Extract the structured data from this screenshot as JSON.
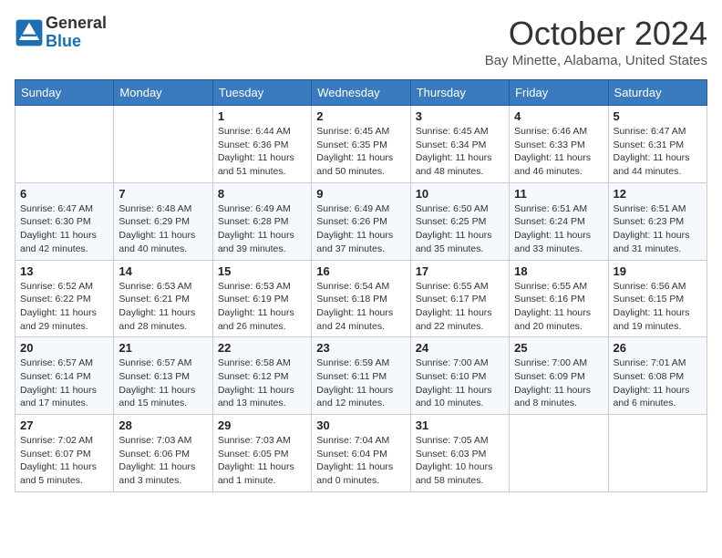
{
  "header": {
    "logo_general": "General",
    "logo_blue": "Blue",
    "month_title": "October 2024",
    "location": "Bay Minette, Alabama, United States"
  },
  "days_of_week": [
    "Sunday",
    "Monday",
    "Tuesday",
    "Wednesday",
    "Thursday",
    "Friday",
    "Saturday"
  ],
  "weeks": [
    [
      {
        "day": "",
        "info": ""
      },
      {
        "day": "",
        "info": ""
      },
      {
        "day": "1",
        "info": "Sunrise: 6:44 AM\nSunset: 6:36 PM\nDaylight: 11 hours and 51 minutes."
      },
      {
        "day": "2",
        "info": "Sunrise: 6:45 AM\nSunset: 6:35 PM\nDaylight: 11 hours and 50 minutes."
      },
      {
        "day": "3",
        "info": "Sunrise: 6:45 AM\nSunset: 6:34 PM\nDaylight: 11 hours and 48 minutes."
      },
      {
        "day": "4",
        "info": "Sunrise: 6:46 AM\nSunset: 6:33 PM\nDaylight: 11 hours and 46 minutes."
      },
      {
        "day": "5",
        "info": "Sunrise: 6:47 AM\nSunset: 6:31 PM\nDaylight: 11 hours and 44 minutes."
      }
    ],
    [
      {
        "day": "6",
        "info": "Sunrise: 6:47 AM\nSunset: 6:30 PM\nDaylight: 11 hours and 42 minutes."
      },
      {
        "day": "7",
        "info": "Sunrise: 6:48 AM\nSunset: 6:29 PM\nDaylight: 11 hours and 40 minutes."
      },
      {
        "day": "8",
        "info": "Sunrise: 6:49 AM\nSunset: 6:28 PM\nDaylight: 11 hours and 39 minutes."
      },
      {
        "day": "9",
        "info": "Sunrise: 6:49 AM\nSunset: 6:26 PM\nDaylight: 11 hours and 37 minutes."
      },
      {
        "day": "10",
        "info": "Sunrise: 6:50 AM\nSunset: 6:25 PM\nDaylight: 11 hours and 35 minutes."
      },
      {
        "day": "11",
        "info": "Sunrise: 6:51 AM\nSunset: 6:24 PM\nDaylight: 11 hours and 33 minutes."
      },
      {
        "day": "12",
        "info": "Sunrise: 6:51 AM\nSunset: 6:23 PM\nDaylight: 11 hours and 31 minutes."
      }
    ],
    [
      {
        "day": "13",
        "info": "Sunrise: 6:52 AM\nSunset: 6:22 PM\nDaylight: 11 hours and 29 minutes."
      },
      {
        "day": "14",
        "info": "Sunrise: 6:53 AM\nSunset: 6:21 PM\nDaylight: 11 hours and 28 minutes."
      },
      {
        "day": "15",
        "info": "Sunrise: 6:53 AM\nSunset: 6:19 PM\nDaylight: 11 hours and 26 minutes."
      },
      {
        "day": "16",
        "info": "Sunrise: 6:54 AM\nSunset: 6:18 PM\nDaylight: 11 hours and 24 minutes."
      },
      {
        "day": "17",
        "info": "Sunrise: 6:55 AM\nSunset: 6:17 PM\nDaylight: 11 hours and 22 minutes."
      },
      {
        "day": "18",
        "info": "Sunrise: 6:55 AM\nSunset: 6:16 PM\nDaylight: 11 hours and 20 minutes."
      },
      {
        "day": "19",
        "info": "Sunrise: 6:56 AM\nSunset: 6:15 PM\nDaylight: 11 hours and 19 minutes."
      }
    ],
    [
      {
        "day": "20",
        "info": "Sunrise: 6:57 AM\nSunset: 6:14 PM\nDaylight: 11 hours and 17 minutes."
      },
      {
        "day": "21",
        "info": "Sunrise: 6:57 AM\nSunset: 6:13 PM\nDaylight: 11 hours and 15 minutes."
      },
      {
        "day": "22",
        "info": "Sunrise: 6:58 AM\nSunset: 6:12 PM\nDaylight: 11 hours and 13 minutes."
      },
      {
        "day": "23",
        "info": "Sunrise: 6:59 AM\nSunset: 6:11 PM\nDaylight: 11 hours and 12 minutes."
      },
      {
        "day": "24",
        "info": "Sunrise: 7:00 AM\nSunset: 6:10 PM\nDaylight: 11 hours and 10 minutes."
      },
      {
        "day": "25",
        "info": "Sunrise: 7:00 AM\nSunset: 6:09 PM\nDaylight: 11 hours and 8 minutes."
      },
      {
        "day": "26",
        "info": "Sunrise: 7:01 AM\nSunset: 6:08 PM\nDaylight: 11 hours and 6 minutes."
      }
    ],
    [
      {
        "day": "27",
        "info": "Sunrise: 7:02 AM\nSunset: 6:07 PM\nDaylight: 11 hours and 5 minutes."
      },
      {
        "day": "28",
        "info": "Sunrise: 7:03 AM\nSunset: 6:06 PM\nDaylight: 11 hours and 3 minutes."
      },
      {
        "day": "29",
        "info": "Sunrise: 7:03 AM\nSunset: 6:05 PM\nDaylight: 11 hours and 1 minute."
      },
      {
        "day": "30",
        "info": "Sunrise: 7:04 AM\nSunset: 6:04 PM\nDaylight: 11 hours and 0 minutes."
      },
      {
        "day": "31",
        "info": "Sunrise: 7:05 AM\nSunset: 6:03 PM\nDaylight: 10 hours and 58 minutes."
      },
      {
        "day": "",
        "info": ""
      },
      {
        "day": "",
        "info": ""
      }
    ]
  ]
}
